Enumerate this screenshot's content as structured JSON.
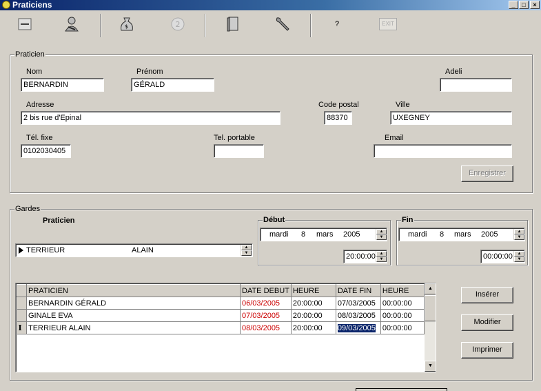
{
  "window": {
    "title": "Praticiens",
    "btn_min": "_",
    "btn_max": "□",
    "btn_close": "×"
  },
  "toolbar": {
    "help_label": "?",
    "exit_label": "EXIT"
  },
  "praticien": {
    "group_label": "Praticien",
    "nom_label": "Nom",
    "nom_value": "BERNARDIN",
    "prenom_label": "Prénom",
    "prenom_value": "GÉRALD",
    "adeli_label": "Adeli",
    "adeli_value": "",
    "adresse_label": "Adresse",
    "adresse_value": "2 bis rue d'Epinal",
    "cp_label": "Code postal",
    "cp_value": "88370",
    "ville_label": "Ville",
    "ville_value": "UXEGNEY",
    "tel_fixe_label": "Tél. fixe",
    "tel_fixe_value": "0102030405",
    "tel_portable_label": "Tel. portable",
    "tel_portable_value": "",
    "email_label": "Email",
    "email_value": "",
    "enregistrer_label": "Enregistrer"
  },
  "gardes": {
    "group_label": "Gardes",
    "praticien_label": "Praticien",
    "praticien_nom": "TERRIEUR",
    "praticien_prenom": "ALAIN",
    "debut": {
      "label": "Début",
      "day_name": "mardi",
      "day": "8",
      "month": "mars",
      "year": "2005",
      "time": "20:00:00"
    },
    "fin": {
      "label": "Fin",
      "day_name": "mardi",
      "day": "8",
      "month": "mars",
      "year": "2005",
      "time": "00:00:00"
    },
    "columns": [
      "PRATICIEN",
      "DATE DEBUT",
      "HEURE",
      "DATE FIN",
      "HEURE"
    ],
    "rows": [
      {
        "praticien": "BERNARDIN GÉRALD",
        "date_debut": "06/03/2005",
        "heure_debut": "20:00:00",
        "date_fin": "07/03/2005",
        "heure_fin": "00:00:00"
      },
      {
        "praticien": "GINALE EVA",
        "date_debut": "07/03/2005",
        "heure_debut": "20:00:00",
        "date_fin": "08/03/2005",
        "heure_fin": "00:00:00"
      },
      {
        "praticien": "TERRIEUR ALAIN",
        "date_debut": "08/03/2005",
        "heure_debut": "20:00:00",
        "date_fin": "09/03/2005",
        "heure_fin": "00:00:00"
      }
    ],
    "inserer_label": "Insérer",
    "modifier_label": "Modifier",
    "imprimer_label": "Imprimer"
  },
  "colors": {
    "title_bar": "#0a246a",
    "date_debut_text": "#cc0000",
    "selection": "#0a246a",
    "face": "#d4d0c8"
  }
}
